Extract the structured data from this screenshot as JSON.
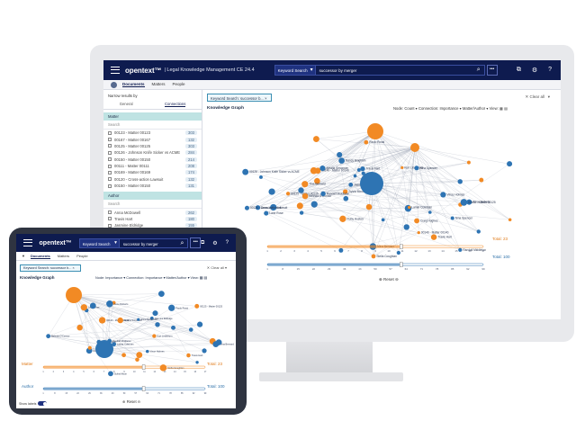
{
  "app": {
    "logo": "opentext™",
    "product": "| Legal Knowledge Management CE 24.4",
    "search_scope": "Keyword Search",
    "query": "successor by merger",
    "tabs": [
      "Documents",
      "Matters",
      "People"
    ]
  },
  "filters": {
    "chip": "Keyword Search: successor b...",
    "clear_all": "Clear all",
    "narrow_label": "Narrow results by",
    "panel_tabs": [
      "General",
      "Connections"
    ],
    "sections": [
      {
        "name": "Matter",
        "search": "Search",
        "items": [
          {
            "label": "00123 - Matter 00123",
            "count": "303"
          },
          {
            "label": "00167 - Matter 00167",
            "count": "132"
          },
          {
            "label": "00125 - Matter 00125",
            "count": "303"
          },
          {
            "label": "00126 - Johnson Knife Sicker vs ACME",
            "count": "284"
          },
          {
            "label": "00150 - Matter 00150",
            "count": "214"
          },
          {
            "label": "00111 - Matter 00111",
            "count": "208"
          },
          {
            "label": "00169 - Matter 00169",
            "count": "174"
          },
          {
            "label": "00120 - Cross-action Lawsuit",
            "count": "132"
          },
          {
            "label": "00150 - Matter 00150",
            "count": "131"
          }
        ]
      },
      {
        "name": "Author",
        "search": "Search",
        "items": [
          {
            "label": "Anna McDowell",
            "count": "262"
          },
          {
            "label": "Travis Hart",
            "count": "180"
          },
          {
            "label": "Jasmine Eldridge",
            "count": "155"
          },
          {
            "label": "Stella Coughlan",
            "count": "143"
          }
        ]
      }
    ]
  },
  "graph": {
    "title": "Knowledge Graph",
    "controls": "Node: Count ▾   Connection: Importance ▾   Matter/Author ▾   View: ▦ ▤",
    "tablet_controls": "Node: Importance ▾  Connection: Importance ▾   Matter/Author ▾  View: ▦ ▤",
    "labels": [
      "00125 - Matter 00125",
      "00140 - Matter 00140",
      "Travis Hart",
      "Nina Spencer",
      "Randall Middleton",
      "Ruby Huston",
      "Amalia Simonsen",
      "Anne Roberts",
      "Lane Rose",
      "Mina Bernard",
      "Jasmine Eldridge",
      "Stella Coughlan",
      "Anna McDowell",
      "Vince Holmes",
      "Lamar Coleman",
      "Sylvia Moon",
      "Kurt Lindstrom",
      "Belinda O'Connor",
      "Paolo Rossi",
      "Craig Hughes",
      "Tina Bernard",
      "00120 - Cross-action Lawsuit",
      "00126 - Johnson Knife Sicker vs ACME",
      "Nancy Bingham"
    ],
    "matter_axis": [
      "1",
      "2",
      "3",
      "4",
      "5",
      "6",
      "7",
      "8",
      "9",
      "10",
      "11",
      "12",
      "13",
      "14",
      "15",
      "16",
      "17"
    ],
    "author_axis": [
      "1",
      "8",
      "15",
      "22",
      "29",
      "36",
      "43",
      "50",
      "57",
      "64",
      "71",
      "78",
      "85",
      "92",
      "99"
    ],
    "total_matter": "Total: 23",
    "total_author": "Total: 100",
    "reset": "Reset",
    "slider_matter_label": "Matter",
    "slider_author_label": "Author",
    "tablet_total_matter": "Total: 23",
    "tablet_total_author": "Total: 100",
    "show_labels": "Show labels"
  },
  "colors": {
    "nav": "#0e1b4f",
    "matter_node": "#f28a24",
    "author_node": "#2e74b3",
    "edge": "#9aa3b2"
  }
}
